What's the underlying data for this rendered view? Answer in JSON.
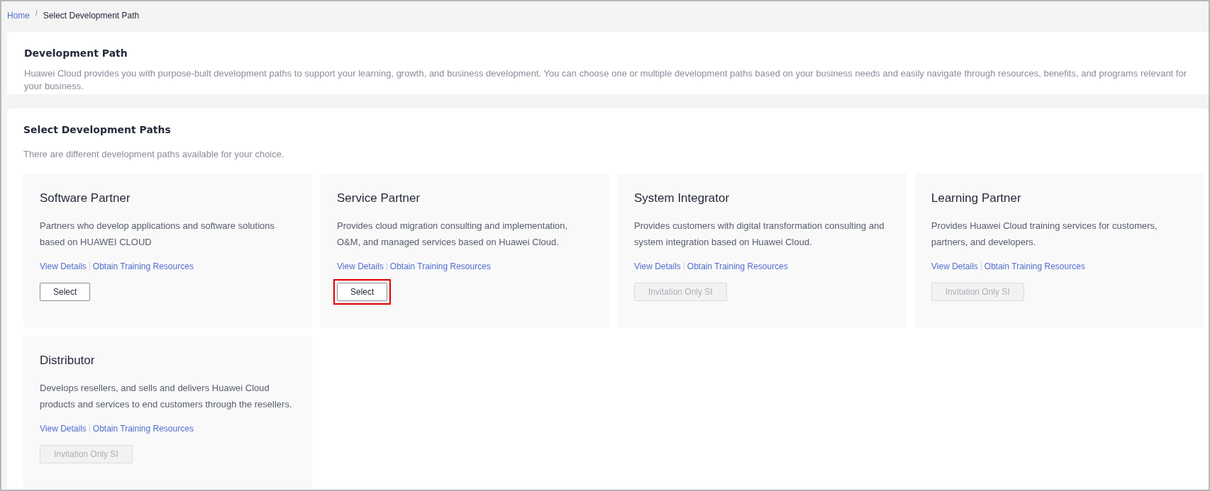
{
  "breadcrumb": [
    {
      "label": "Home",
      "link": true
    },
    {
      "label": "Select Development Path",
      "link": false
    }
  ],
  "breadcrumb_separator": "/",
  "intro": {
    "title": "Development Path",
    "description": "Huawei Cloud provides you with purpose-built development paths to support your learning, growth, and business development. You can choose one or multiple development paths based on your business needs and easily navigate through resources, benefits, and programs relevant for your business."
  },
  "paths_section": {
    "title": "Select Development Paths",
    "subtitle": "There are different development paths available for your choice."
  },
  "paths": [
    {
      "title": "Software Partner",
      "description": "Partners who develop applications and software solutions based on HUAWEI CLOUD",
      "links": [
        "View Details",
        "Obtain Training Resources"
      ],
      "button": {
        "label": "Select",
        "disabled": false,
        "highlighted": false
      }
    },
    {
      "title": "Service Partner",
      "description": "Provides cloud migration consulting and implementation, O&M, and managed services based on Huawei Cloud.",
      "links": [
        "View Details",
        "Obtain Training Resources"
      ],
      "button": {
        "label": "Select",
        "disabled": false,
        "highlighted": true
      }
    },
    {
      "title": "System Integrator",
      "description": "Provides customers with digital transformation consulting and system integration based on Huawei Cloud.",
      "links": [
        "View Details",
        "Obtain Training Resources"
      ],
      "button": {
        "label": "Invitation Only SI",
        "disabled": true,
        "highlighted": false
      }
    },
    {
      "title": "Learning Partner",
      "description": "Provides Huawei Cloud training services for customers, partners, and developers.",
      "links": [
        "View Details",
        "Obtain Training Resources"
      ],
      "button": {
        "label": "Invitation Only SI",
        "disabled": true,
        "highlighted": false
      }
    },
    {
      "title": "Distributor",
      "description": "Develops resellers, and sells and delivers Huawei Cloud products and services to end customers through the resellers.",
      "links": [
        "View Details",
        "Obtain Training Resources"
      ],
      "button": {
        "label": "Invitation Only SI",
        "disabled": true,
        "highlighted": false
      }
    }
  ]
}
